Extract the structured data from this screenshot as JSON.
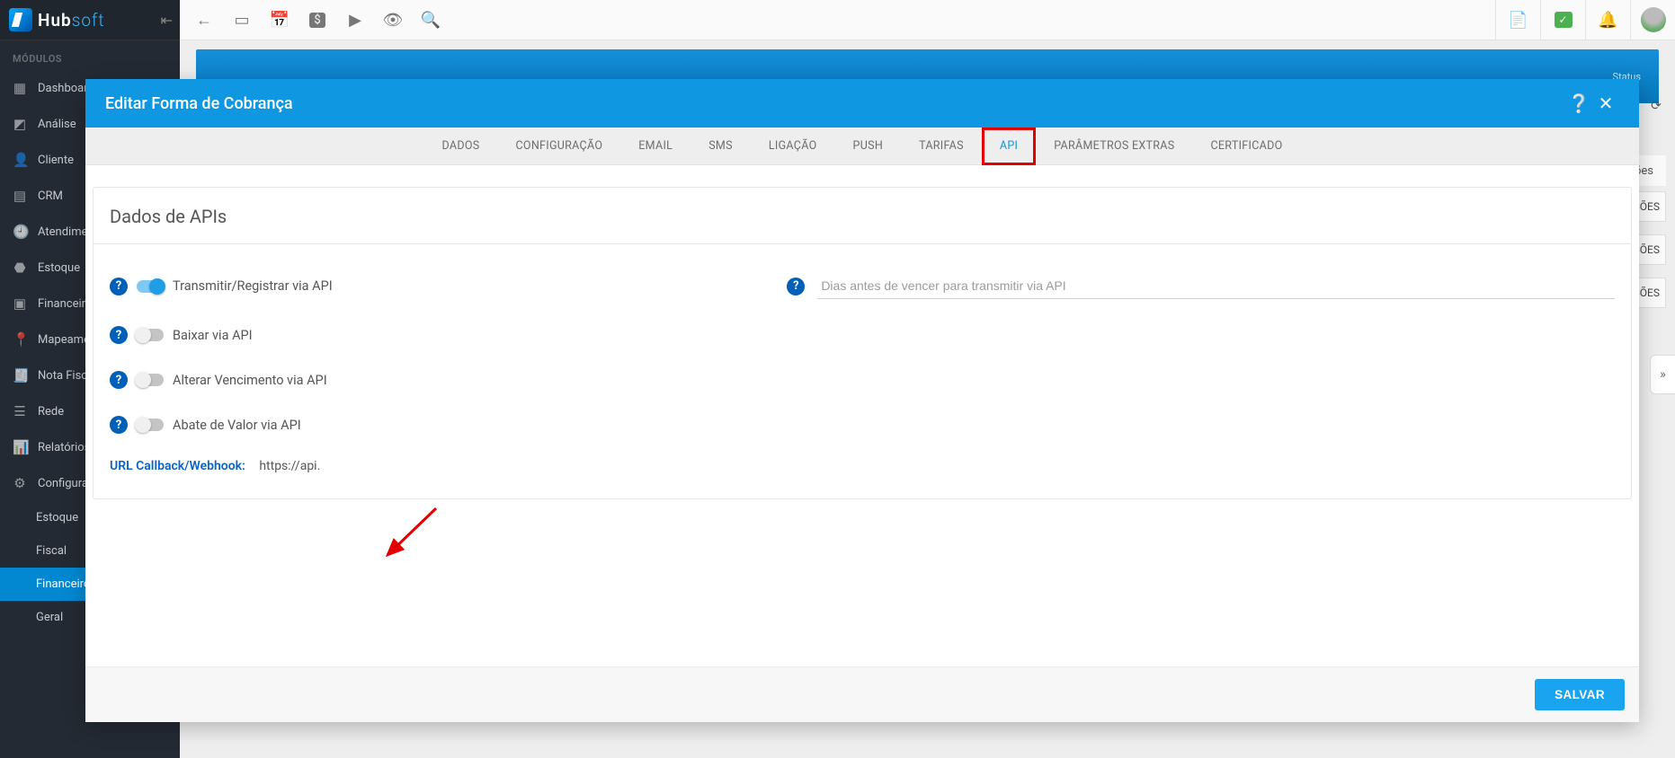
{
  "brand_primary": "Hub",
  "brand_secondary": "soft",
  "sidebar_header": "MÓDULOS",
  "sidebar": [
    {
      "icon": "▦",
      "label": "Dashboard"
    },
    {
      "icon": "◩",
      "label": "Análise"
    },
    {
      "icon": "👤",
      "label": "Cliente"
    },
    {
      "icon": "▤",
      "label": "CRM"
    },
    {
      "icon": "🕘",
      "label": "Atendimento"
    },
    {
      "icon": "⬣",
      "label": "Estoque"
    },
    {
      "icon": "▣",
      "label": "Financeiro"
    },
    {
      "icon": "📍",
      "label": "Mapeamento"
    },
    {
      "icon": "🧾",
      "label": "Nota Fiscal"
    },
    {
      "icon": "☰",
      "label": "Rede"
    },
    {
      "icon": "📊",
      "label": "Relatórios"
    },
    {
      "icon": "⚙",
      "label": "Configurações"
    }
  ],
  "sidebar_sub": [
    "Estoque",
    "Fiscal",
    "Financeiro",
    "Geral"
  ],
  "sidebar_sub_active_index": 2,
  "page_strip": {
    "status_label": "Status"
  },
  "under_subheader": "Ações",
  "under_right_cards": [
    "AÇÕES",
    "AÇÕES",
    "AÇÕES"
  ],
  "modal": {
    "title": "Editar Forma de Cobrança",
    "tabs": [
      "DADOS",
      "CONFIGURAÇÃO",
      "EMAIL",
      "SMS",
      "LIGAÇÃO",
      "PUSH",
      "TARIFAS",
      "API",
      "PARÂMETROS EXTRAS",
      "CERTIFICADO"
    ],
    "active_tab_index": 7,
    "highlight_tab_index": 7,
    "panel_title": "Dados de APIs",
    "toggles": [
      {
        "label": "Transmitir/Registrar via API",
        "on": true
      },
      {
        "label": "Baixar via API",
        "on": false
      },
      {
        "label": "Alterar Vencimento via API",
        "on": false
      },
      {
        "label": "Abate de Valor via API",
        "on": false
      }
    ],
    "dias_placeholder": "Dias antes de vencer para transmitir via API",
    "url_label": "URL Callback/Webhook:",
    "url_value": "https://api.",
    "save_label": "SALVAR"
  }
}
